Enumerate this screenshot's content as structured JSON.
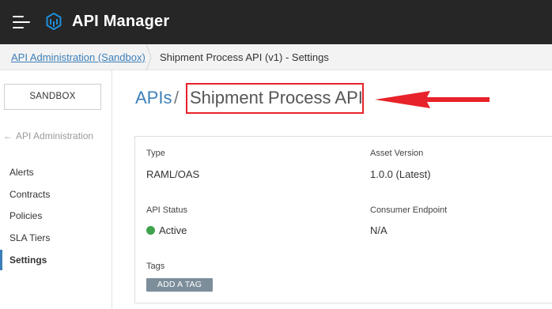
{
  "header": {
    "app_title": "API Manager",
    "menu_icon": "hamburger-menu-icon",
    "logo_icon": "api-manager-logo-icon"
  },
  "breadcrumb": {
    "parent": "API Administration (Sandbox)",
    "current": "Shipment Process API (v1) - Settings"
  },
  "sidebar": {
    "environment": "SANDBOX",
    "back_label": "API Administration",
    "back_icon": "arrow-left-icon",
    "items": [
      {
        "label": "Alerts"
      },
      {
        "label": "Contracts"
      },
      {
        "label": "Policies"
      },
      {
        "label": "SLA Tiers"
      },
      {
        "label": "Settings",
        "active": true
      }
    ]
  },
  "main": {
    "heading_root": "APIs",
    "heading_sep": "/",
    "heading_name": "Shipment Process API",
    "annotation_color": "#e8222a"
  },
  "details": {
    "type_label": "Type",
    "type_value": "RAML/OAS",
    "asset_version_label": "Asset Version",
    "asset_version_value": "1.0.0 (Latest)",
    "api_status_label": "API Status",
    "api_status_value": "Active",
    "status_color": "#3ea34a",
    "consumer_endpoint_label": "Consumer Endpoint",
    "consumer_endpoint_value": "N/A",
    "tags_label": "Tags",
    "add_tag_label": "ADD A TAG"
  },
  "colors": {
    "topbar": "#262626",
    "link": "#3c7fb8"
  }
}
